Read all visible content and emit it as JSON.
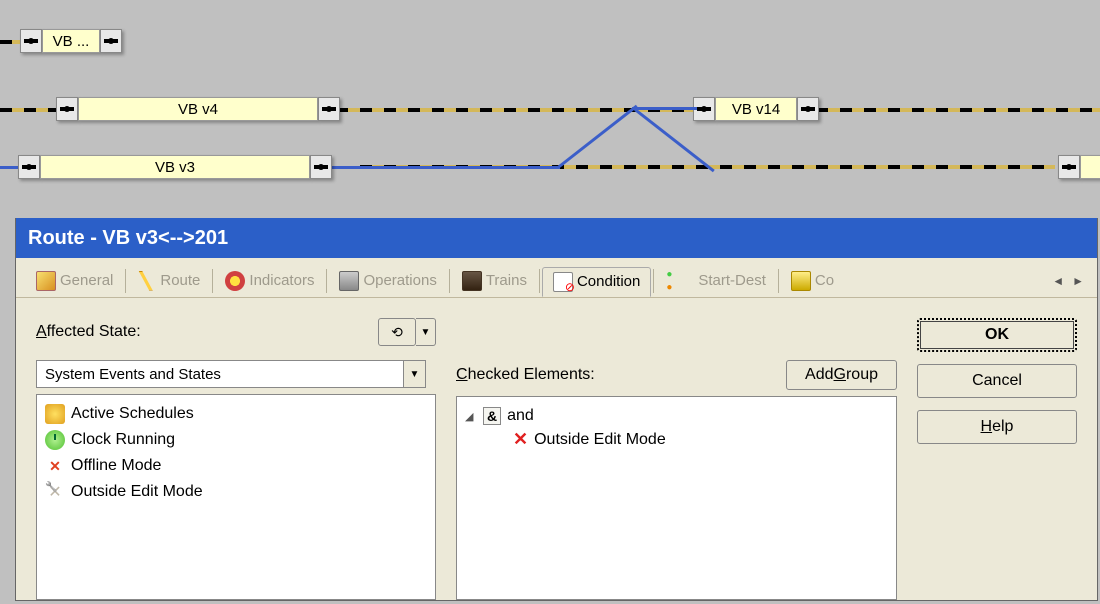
{
  "track": {
    "block_top": "VB ...",
    "block_v4": "VB v4",
    "block_v14": "VB v14",
    "block_v3": "VB v3"
  },
  "dialog": {
    "title": "Route - VB v3<-->201",
    "tabs": {
      "general": "General",
      "route": "Route",
      "indicators": "Indicators",
      "operations": "Operations",
      "trains": "Trains",
      "condition": "Condition",
      "startdest": "Start-Dest",
      "co": "Co"
    },
    "affected_state_label_pre": "A",
    "affected_state_label_post": "ffected State:",
    "combo_value": "System Events and States",
    "list": {
      "active_schedules": "Active Schedules",
      "clock_running": "Clock Running",
      "offline_mode": "Offline Mode",
      "outside_edit_mode": "Outside Edit Mode"
    },
    "checked_label_pre": "C",
    "checked_label_post": "hecked Elements:",
    "add_group_pre": "Add ",
    "add_group_u": "G",
    "add_group_post": "roup",
    "tree": {
      "and": "and",
      "item1": "Outside Edit Mode"
    },
    "buttons": {
      "ok": "OK",
      "cancel": "Cancel",
      "help_u": "H",
      "help_post": "elp"
    }
  }
}
